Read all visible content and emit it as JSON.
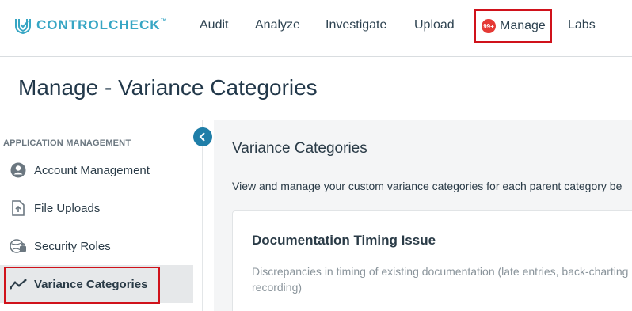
{
  "header": {
    "logo": {
      "part1": "CONTROL",
      "part2": "CHECK",
      "tm": "™"
    },
    "nav": {
      "audit": "Audit",
      "analyze": "Analyze",
      "investigate": "Investigate",
      "upload": "Upload",
      "manage": "Manage",
      "manage_badge": "99+",
      "labs": "Labs"
    }
  },
  "page_title": "Manage - Variance Categories",
  "sidebar": {
    "heading": "APPLICATION MANAGEMENT",
    "items": [
      {
        "label": "Account Management",
        "icon": "account-icon"
      },
      {
        "label": "File Uploads",
        "icon": "file-upload-icon"
      },
      {
        "label": "Security Roles",
        "icon": "security-roles-icon"
      },
      {
        "label": "Variance Categories",
        "icon": "trend-line-icon",
        "active": true
      }
    ]
  },
  "main": {
    "title": "Variance Categories",
    "description": "View and manage your custom variance categories for each parent category be",
    "card": {
      "title": "Documentation Timing Issue",
      "description": "Discrepancies in timing of existing documentation (late entries, back-charting recording)"
    }
  },
  "colors": {
    "accent": "#37a6c4",
    "highlight_border": "#d0121b",
    "badge": "#e53935",
    "collapse_button": "#1f7ea8"
  }
}
